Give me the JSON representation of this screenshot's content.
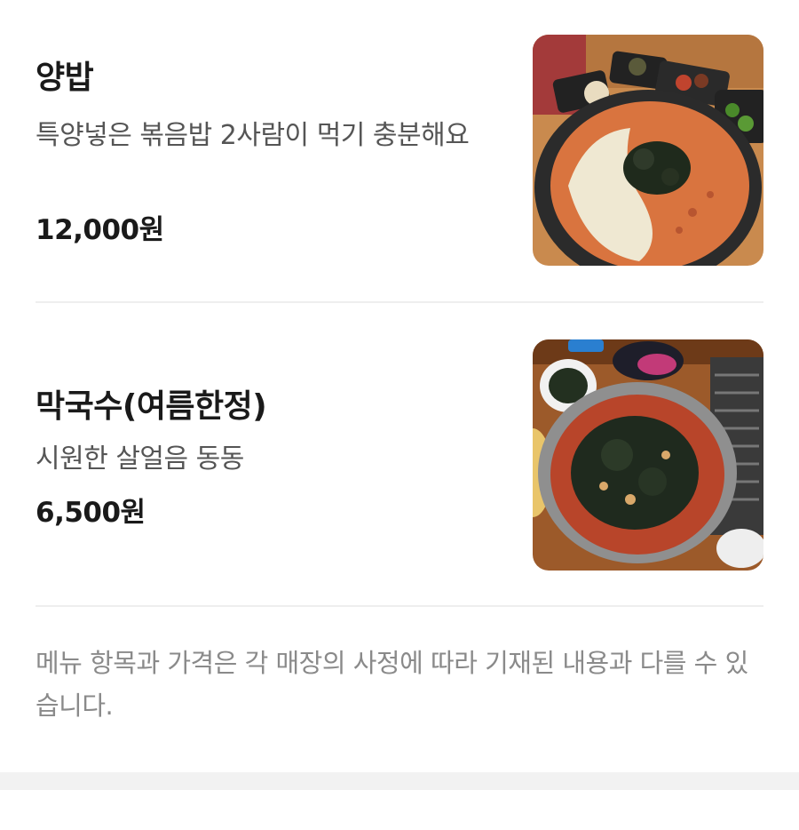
{
  "menu": {
    "items": [
      {
        "name": "양밥",
        "description": "특양넣은 볶음밥 2사람이 먹기 충분해요",
        "price": "12,000원",
        "photo_icon": "fried-rice-photo"
      },
      {
        "name": "막국수(여름한정)",
        "description": "시원한 살얼음 동동",
        "price": "6,500원",
        "photo_icon": "buckwheat-noodle-photo"
      }
    ],
    "notice": "메뉴 항목과 가격은 각 매장의 사정에 따라 기재된 내용과 다를 수 있습니다."
  },
  "colors": {
    "text_primary": "#1a1a1a",
    "text_secondary": "#555555",
    "text_notice": "#8a8a8a",
    "divider": "#eeeeee",
    "footer_band": "#f2f2f2"
  }
}
